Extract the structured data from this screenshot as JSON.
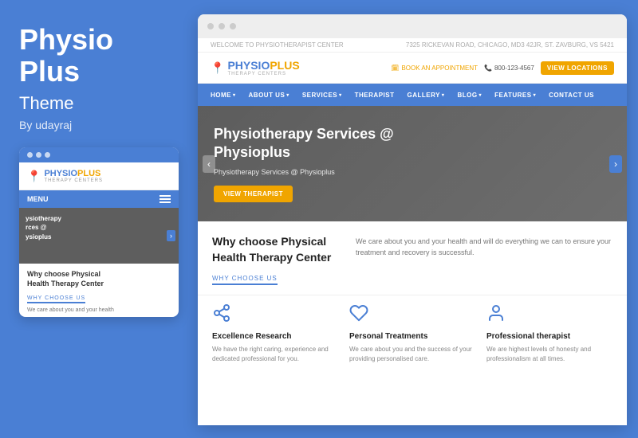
{
  "leftPanel": {
    "title": "Physio\nPlus",
    "subtitle": "Theme",
    "author": "By udayraj"
  },
  "mobileMockup": {
    "dots": [
      "●",
      "●",
      "●"
    ],
    "logo": {
      "pin": "📍",
      "nameStart": "PHYSIO",
      "nameEnd": "PLUS",
      "tagline": "THERAPY CENTERS"
    },
    "menu": "MENU",
    "hero": {
      "line1": "ysiotherapy",
      "line2": "rces @",
      "line3": "ysioplus"
    },
    "whyTitle": "Why choose Physical Health Therapy Center",
    "whyLabel": "WHY CHOOSE US",
    "desc": "We care about you and your health"
  },
  "browserDots": [
    "●",
    "●",
    "●"
  ],
  "topBar": {
    "left": "WELCOME TO PHYSIOTHERAPIST CENTER",
    "right": "7325 RICKEVAN ROAD, CHICAGO, MD3 42JR, ST. ZAVBURG, VS 5421"
  },
  "header": {
    "logoNameStart": "PHYSIO",
    "logoNameEnd": "PLUS",
    "logoTagline": "THERAPY CENTERS",
    "appointmentLabel": "BOOK AN APPOINTMENT",
    "phoneLabel": "800-123-4567",
    "viewLocationsLabel": "VIEW LOCATIONS"
  },
  "nav": {
    "items": [
      {
        "label": "HOME",
        "hasDropdown": true
      },
      {
        "label": "ABOUT US",
        "hasDropdown": true
      },
      {
        "label": "SERVICES",
        "hasDropdown": true
      },
      {
        "label": "THERAPIST",
        "hasDropdown": false
      },
      {
        "label": "GALLERY",
        "hasDropdown": true
      },
      {
        "label": "BLOG",
        "hasDropdown": true
      },
      {
        "label": "FEATURES",
        "hasDropdown": true
      },
      {
        "label": "CONTACT US",
        "hasDropdown": false
      }
    ]
  },
  "hero": {
    "title": "Physiotherapy Services @\nPhysioplus",
    "subtitle": "Physiotherapy Services @ Physioplus",
    "ctaLabel": "VIEW THERAPIST"
  },
  "whySection": {
    "title": "Why choose Physical Health Therapy Center",
    "label": "WHY CHOOSE US",
    "description": "We care about you and your health and will do everything we can to ensure your treatment and recovery is successful."
  },
  "features": [
    {
      "iconType": "share",
      "title": "Excellence Research",
      "description": "We have the right caring, experience and dedicated professional for you."
    },
    {
      "iconType": "heart",
      "title": "Personal Treatments",
      "description": "We care about you and the success of your providing personalised care."
    },
    {
      "iconType": "person",
      "title": "Professional therapist",
      "description": "We are highest levels of honesty and professionalism at all times."
    }
  ],
  "colors": {
    "primary": "#4a7fd4",
    "accent": "#f0a500",
    "text": "#222",
    "muted": "#777"
  }
}
